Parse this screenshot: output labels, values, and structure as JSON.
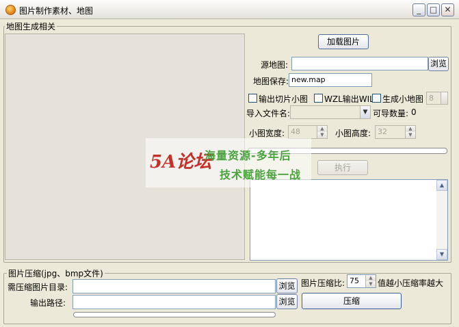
{
  "window": {
    "title": "图片制作素材、地图",
    "minimize": "_",
    "maximize": "□",
    "close": "✕"
  },
  "map_group": {
    "legend": "地图生成相关",
    "load_image_button": "加载图片",
    "source_map_label": "源地图:",
    "source_map_value": "",
    "browse_button": "浏览",
    "map_save_label": "地图保存:",
    "map_save_value": "new.map",
    "checkbox_tiles": "输出切片小图",
    "checkbox_wzl": "WZL输出WIL",
    "checkbox_minimap": "生成小地图",
    "minimap_value": "8",
    "import_filename_label": "导入文件名:",
    "import_filename_value": "",
    "importable_count_label": "可导数量:",
    "importable_count_value": "0",
    "tile_width_label": "小图宽度:",
    "tile_width_value": "48",
    "tile_height_label": "小图高度:",
    "tile_height_value": "32",
    "progress": 0,
    "execute_button": "执行"
  },
  "compress_group": {
    "legend": "图片压缩(jpg、bmp文件)",
    "source_dir_label": "需压缩图片目录:",
    "source_dir_value": "",
    "output_path_label": "输出路径:",
    "output_path_value": "",
    "browse_button_1": "浏览",
    "browse_button_2": "浏览",
    "ratio_label": "图片压缩比:",
    "ratio_value": "75",
    "ratio_hint": "值越小压缩率越大",
    "compress_button": "压缩",
    "progress": 0
  },
  "watermark": {
    "logo": "5A论坛",
    "line1": "海量资源-多年后",
    "line2": "技术赋能每一战"
  },
  "icons": [
    "app-icon",
    "minimize-icon",
    "maximize-icon",
    "close-icon",
    "dropdown-arrow-icon",
    "spin-up-icon",
    "spin-down-icon",
    "scroll-up-icon",
    "scroll-down-icon"
  ]
}
